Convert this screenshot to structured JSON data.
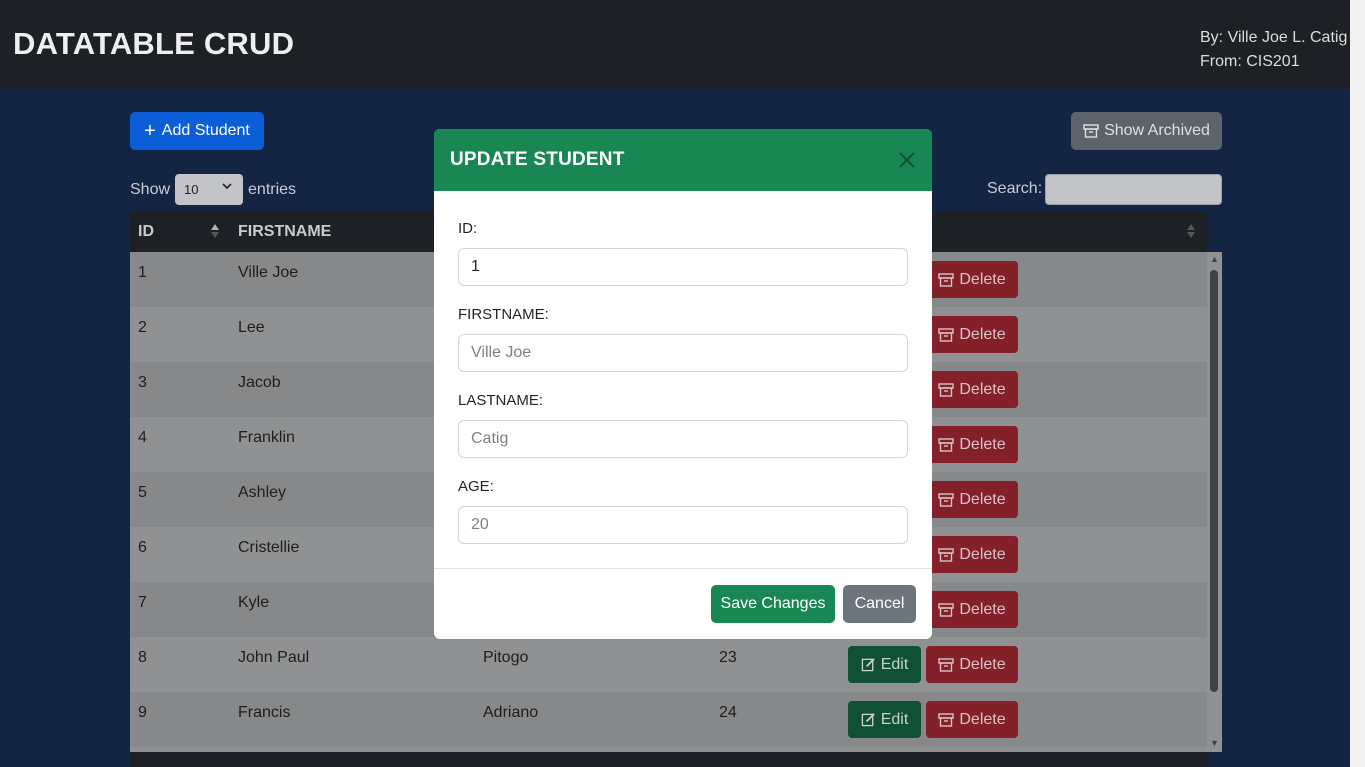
{
  "header": {
    "title": "DATATABLE CRUD",
    "by": "By: Ville Joe L. Catig",
    "from": "From: CIS201"
  },
  "toolbar": {
    "add_label": "Add Student",
    "archive_label": "Show Archived",
    "show_label": "Show",
    "entries_value": "10",
    "entries_label": "entries",
    "search_label": "Search:",
    "search_value": ""
  },
  "table": {
    "columns": [
      "ID",
      "FIRSTNAME"
    ],
    "edit_label": "Edit",
    "delete_label": "Delete",
    "rows": [
      {
        "id": "1",
        "firstname": "Ville Joe",
        "lastname": "",
        "age": ""
      },
      {
        "id": "2",
        "firstname": "Lee",
        "lastname": "",
        "age": ""
      },
      {
        "id": "3",
        "firstname": "Jacob",
        "lastname": "",
        "age": ""
      },
      {
        "id": "4",
        "firstname": "Franklin",
        "lastname": "",
        "age": ""
      },
      {
        "id": "5",
        "firstname": "Ashley",
        "lastname": "",
        "age": ""
      },
      {
        "id": "6",
        "firstname": "Cristellie",
        "lastname": "",
        "age": ""
      },
      {
        "id": "7",
        "firstname": "Kyle",
        "lastname": "",
        "age": ""
      },
      {
        "id": "8",
        "firstname": "John Paul",
        "lastname": "Pitogo",
        "age": "23"
      },
      {
        "id": "9",
        "firstname": "Francis",
        "lastname": "Adriano",
        "age": "24"
      }
    ]
  },
  "modal": {
    "title": "UPDATE STUDENT",
    "id_label": "ID:",
    "id_value": "1",
    "firstname_label": "FIRSTNAME:",
    "firstname_placeholder": "Ville Joe",
    "lastname_label": "LASTNAME:",
    "lastname_placeholder": "Catig",
    "age_label": "AGE:",
    "age_placeholder": "20",
    "save_label": "Save Changes",
    "cancel_label": "Cancel"
  },
  "colors": {
    "modal_header": "#198754",
    "primary": "#0b5ed7",
    "danger": "#dc3545",
    "secondary": "#6c757d"
  }
}
